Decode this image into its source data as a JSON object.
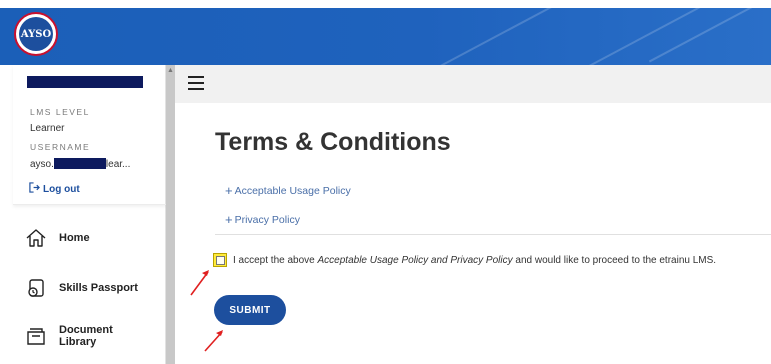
{
  "colors": {
    "brand_blue": "#1d4f9e",
    "banner_blue": "#1f62bd",
    "highlight_yellow": "#ffeb3b",
    "annotation_red": "#e02020"
  },
  "logo": {
    "text": "AYSO"
  },
  "sidebar": {
    "lms_level_label": "LMS LEVEL",
    "lms_level_value": "Learner",
    "username_label": "USERNAME",
    "username_prefix": "ayso.",
    "username_suffix": "lear...",
    "logout_label": "Log out",
    "items": [
      {
        "label": "Home",
        "icon": "home-icon"
      },
      {
        "label": "Skills Passport",
        "icon": "passport-icon"
      },
      {
        "label": "Document Library",
        "icon": "document-library-icon"
      }
    ]
  },
  "main": {
    "title": "Terms & Conditions",
    "policies": [
      {
        "label": "Acceptable Usage Policy"
      },
      {
        "label": "Privacy Policy"
      }
    ],
    "accept": {
      "prefix": "I accept the above",
      "emphasis": "Acceptable Usage Policy and Privacy Policy",
      "suffix": "and would like to proceed to the etrainu LMS."
    },
    "submit_label": "SUBMIT"
  }
}
